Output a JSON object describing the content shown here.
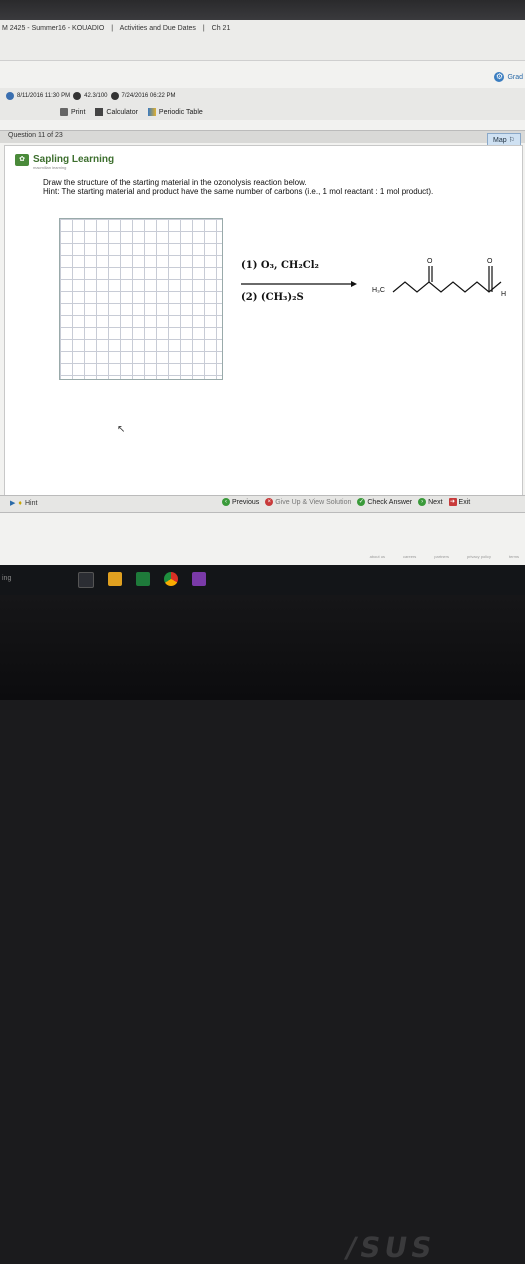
{
  "breadcrumb": [
    "M 2425 - Summer16 - KOUADIO",
    "|",
    "Activities and Due Dates",
    "|",
    "Ch 21"
  ],
  "grade_label": "Grad",
  "info": {
    "due": "8/11/2016 11:30 PM",
    "score": "42.3/100",
    "printed": "7/24/2016 06:22 PM"
  },
  "tools": {
    "print": "Print",
    "calculator": "Calculator",
    "periodic": "Periodic Table"
  },
  "question": "Question 11 of 23",
  "map_label": "Map",
  "brand": {
    "name": "Sapling Learning",
    "tagline": "macmillan learning"
  },
  "prompt": {
    "line1": "Draw the structure of the starting material in the ozonolysis reaction below.",
    "line2": "Hint: The starting material and product have the same number of carbons (i.e., 1 mol reactant : 1 mol product)."
  },
  "reaction": {
    "step1": "(1) O₃, CH₂Cl₂",
    "step2": "(2) (CH₃)₂S",
    "h3c": "H₃C",
    "o": "O",
    "h": "H"
  },
  "footer": {
    "hint": "Hint",
    "previous": "Previous",
    "give_up": "Give Up & View Solution",
    "check": "Check Answer",
    "next": "Next",
    "exit": "Exit"
  },
  "links": [
    "about us",
    "careers",
    "partners",
    "privacy policy",
    "terms"
  ],
  "taskbar_text": "ing"
}
